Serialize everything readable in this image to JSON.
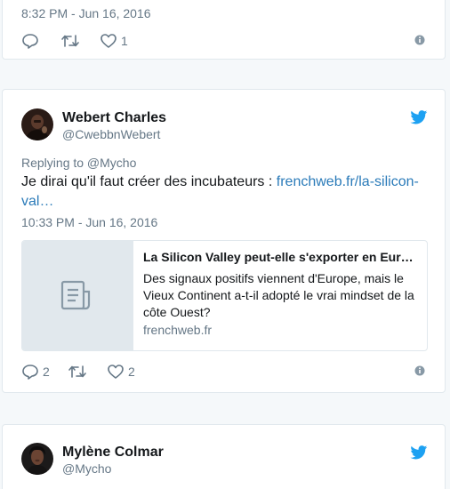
{
  "tweets": [
    {
      "timestamp": "8:32 PM - Jun 16, 2016",
      "actions": {
        "reply_count": "",
        "retweet_count": "",
        "like_count": "1"
      }
    },
    {
      "author": {
        "name": "Webert Charles",
        "handle": "@CwebbnWebert"
      },
      "replying_to": "Replying to @Mycho",
      "text": "Je dirai qu'il faut créer des incubateurs : ",
      "link_text": "frenchweb.fr/la-silicon-val…",
      "timestamp": "10:33 PM - Jun 16, 2016",
      "card": {
        "title": "La Silicon Valley peut-elle s'exporter en Eur…",
        "description": "Des signaux positifs viennent d'Europe, mais le Vieux Continent a-t-il adopté le vrai mindset de la côte Ouest?",
        "domain": "frenchweb.fr"
      },
      "actions": {
        "reply_count": "2",
        "retweet_count": "",
        "like_count": "2"
      }
    },
    {
      "author": {
        "name": "Mylène Colmar",
        "handle": "@Mycho"
      }
    }
  ],
  "colors": {
    "twitter_blue": "#1da1f2",
    "link_blue": "#2b7bb9",
    "secondary_text": "#657786",
    "border": "#e1e8ed"
  },
  "icons": [
    "reply-icon",
    "retweet-icon",
    "like-icon",
    "info-icon",
    "twitter-bird-icon",
    "document-icon"
  ]
}
